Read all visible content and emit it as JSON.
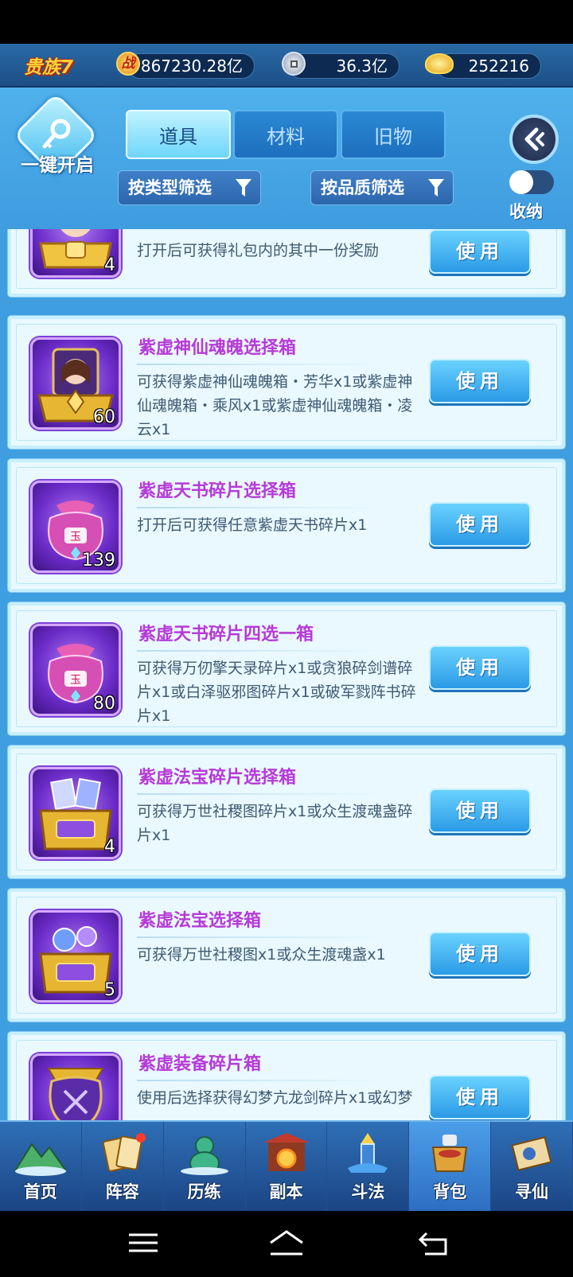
{
  "header": {
    "rank": "贵族7",
    "power_badge": "战",
    "power": "867230.28亿",
    "copper": "36.3亿",
    "gold": "252216"
  },
  "controls": {
    "one_key_open": "一键开启",
    "tabs": [
      {
        "label": "道具",
        "active": true
      },
      {
        "label": "材料",
        "active": false
      },
      {
        "label": "旧物",
        "active": false
      }
    ],
    "filter_type": "按类型筛选",
    "filter_quality": "按品质筛选",
    "collapse_label": "收纳",
    "collapse_on": false
  },
  "items": [
    {
      "name": "",
      "desc": "打开后可获得礼包内的其中一份奖励",
      "count": "4",
      "icon": "gold-chest-with-fairy-icon",
      "use": "使用"
    },
    {
      "name": "紫虚神仙魂魄选择箱",
      "desc": "可获得紫虚神仙魂魄箱・芳华x1或紫虚神仙魂魄箱・乘风x1或紫虚神仙魂魄箱・凌云x1",
      "count": "60",
      "icon": "fairy-portrait-chest-icon",
      "use": "使用"
    },
    {
      "name": "紫虚天书碎片选择箱",
      "desc": "打开后可获得任意紫虚天书碎片x1",
      "count": "139",
      "icon": "purple-pouch-icon",
      "use": "使用"
    },
    {
      "name": "紫虚天书碎片四选一箱",
      "desc": "可获得万仞擎天录碎片x1或贪狼碎剑谱碎片x1或白泽驱邪图碎片x1或破军戮阵书碎片x1",
      "count": "80",
      "icon": "purple-pouch-icon",
      "use": "使用"
    },
    {
      "name": "紫虚法宝碎片选择箱",
      "desc": "可获得万世社稷图碎片x1或众生渡魂盏碎片x1",
      "count": "4",
      "icon": "treasure-chest-icon",
      "use": "使用"
    },
    {
      "name": "紫虚法宝选择箱",
      "desc": "可获得万世社稷图x1或众生渡魂盏x1",
      "count": "5",
      "icon": "treasure-chest-icon",
      "use": "使用"
    },
    {
      "name": "紫虚装备碎片箱",
      "desc": "使用后选择获得幻梦亢龙剑碎片x1或幻梦",
      "count": "",
      "icon": "equipment-chest-icon",
      "use": "使用"
    }
  ],
  "nav": [
    {
      "label": "首页",
      "icon": "home-mountain-icon",
      "active": false
    },
    {
      "label": "阵容",
      "icon": "cards-icon",
      "active": false
    },
    {
      "label": "历练",
      "icon": "gourd-icon",
      "active": false
    },
    {
      "label": "副本",
      "icon": "temple-gate-icon",
      "active": false
    },
    {
      "label": "斗法",
      "icon": "tower-icon",
      "active": false
    },
    {
      "label": "背包",
      "icon": "bag-icon",
      "active": true
    },
    {
      "label": "寻仙",
      "icon": "scroll-icon",
      "active": false
    }
  ],
  "colors": {
    "accent": "#3f9ee0",
    "item_name": "#b63ad8",
    "use_button": "#2a9ae6"
  }
}
